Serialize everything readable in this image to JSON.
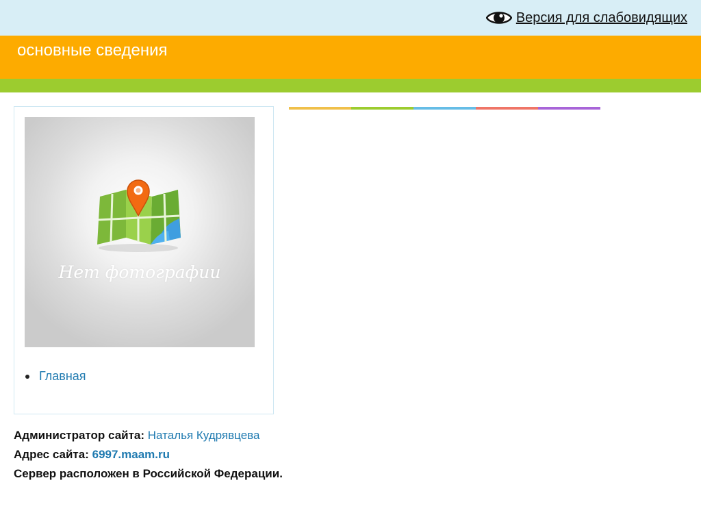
{
  "header": {
    "accessibility_link": "Версия для слабовидящих",
    "accessibility_icon": "eye-icon",
    "title": "основные сведения"
  },
  "colors": {
    "topbar": "#d8eef6",
    "orange_band": "#fdab00",
    "green_band": "#9ccc2f",
    "link": "#1f7ab0",
    "stripe": [
      "#f0c04a",
      "#9ccc2f",
      "#66bde6",
      "#ef7567",
      "#a865d8"
    ]
  },
  "sidebar": {
    "photo_placeholder_text": "Нет фотографии",
    "photo_icon": "map-pin-icon",
    "menu": [
      {
        "label": "Главная"
      }
    ]
  },
  "footer": {
    "admin_label": "Администратор сайта:",
    "admin_name": "Наталья Кудрявцева",
    "address_label": "Адрес сайта:",
    "address_value": "6997.maam.ru",
    "server_text": "Сервер расположен в Российской Федерации."
  }
}
